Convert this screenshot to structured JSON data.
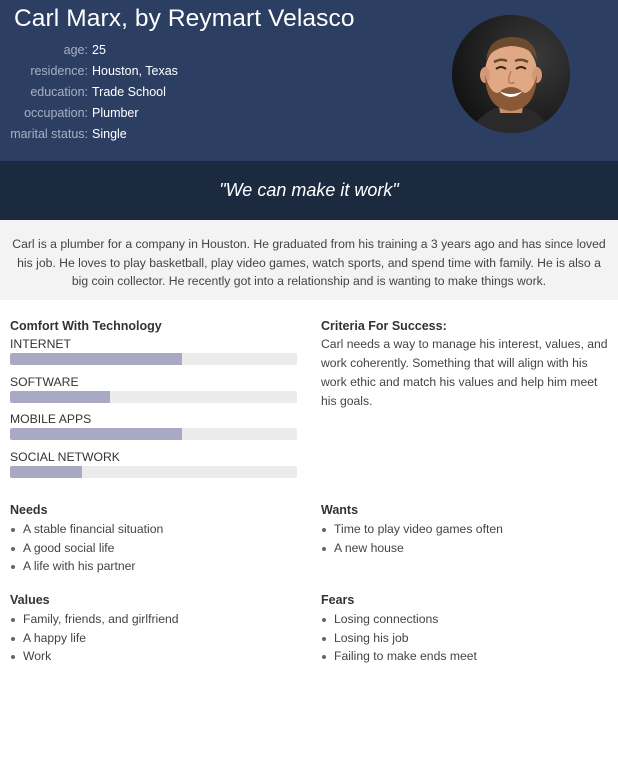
{
  "header": {
    "name": "Carl Marx, by Reymart Velasco",
    "info": [
      {
        "key": "age:",
        "value": "25"
      },
      {
        "key": "residence:",
        "value": "Houston, Texas"
      },
      {
        "key": "education:",
        "value": "Trade School"
      },
      {
        "key": "occupation:",
        "value": "Plumber"
      },
      {
        "key": "marital status:",
        "value": "Single"
      }
    ]
  },
  "quote": "\"We can make it work\"",
  "bio": "Carl is a plumber for a company in Houston. He graduated from his training a 3 years ago and has since loved his job. He loves to play basketball, play video games, watch sports, and spend time with family. He is also a big coin collector. He recently got into a relationship and is wanting to make things work.",
  "technology": {
    "title": "Comfort With Technology",
    "items": [
      {
        "label": "INTERNET",
        "level": 0.6
      },
      {
        "label": "SOFTWARE",
        "level": 0.35
      },
      {
        "label": "MOBILE APPS",
        "level": 0.6
      },
      {
        "label": "SOCIAL NETWORK",
        "level": 0.25
      }
    ]
  },
  "criteria": {
    "title": "Criteria For Success:",
    "text": "Carl needs a way to manage his interest, values, and work coherently. Something that will align with his work ethic and match his values and help him meet his goals."
  },
  "needs": {
    "title": "Needs",
    "items": [
      "A stable financial situation",
      "A good social life",
      "A life with his partner"
    ]
  },
  "wants": {
    "title": "Wants",
    "items": [
      "Time to play video games often",
      "A new house"
    ]
  },
  "values": {
    "title": "Values",
    "items": [
      "Family, friends, and girlfriend",
      "A happy life",
      "Work"
    ]
  },
  "fears": {
    "title": "Fears",
    "items": [
      "Losing connections",
      "Losing his job",
      "Failing to make ends meet"
    ]
  },
  "colors": {
    "header_bg": "#2c3f62",
    "quote_bg": "#1c2a40",
    "bio_bg": "#f3f3f3",
    "bar_fill": "#a9a9c5",
    "bar_track": "#ebebeb"
  },
  "icons": {
    "avatar": "bearded-man-portrait"
  }
}
